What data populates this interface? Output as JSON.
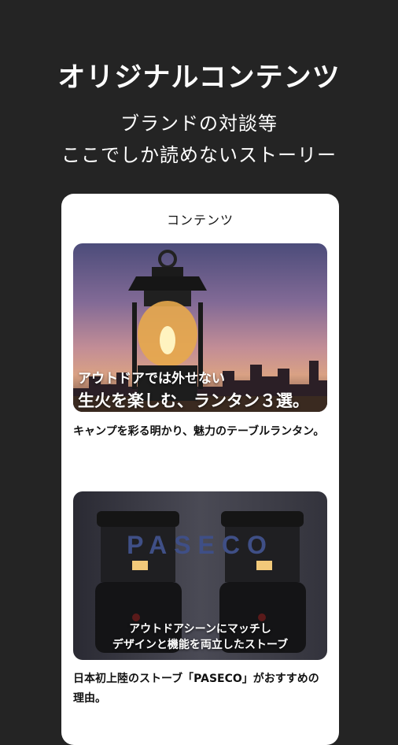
{
  "header": {
    "headline": "オリジナルコンテンツ",
    "sub1": "ブランドの対談等",
    "sub2": "ここでしか読めないストーリー"
  },
  "card": {
    "title": "コンテンツ",
    "items": [
      {
        "overlay_line1": "アウトドアでは外せない",
        "overlay_line2": "生火を楽しむ、ランタン３選。",
        "caption": "キャンプを彩る明かり、魅力のテーブルランタン。"
      },
      {
        "brand": "PASECO",
        "overlay_line1": "アウトドアシーンにマッチし",
        "overlay_line2": "デザインと機能を両立したストーブ",
        "caption": "日本初上陸のストーブ「PASECO」がおすすめの理由。"
      }
    ]
  }
}
